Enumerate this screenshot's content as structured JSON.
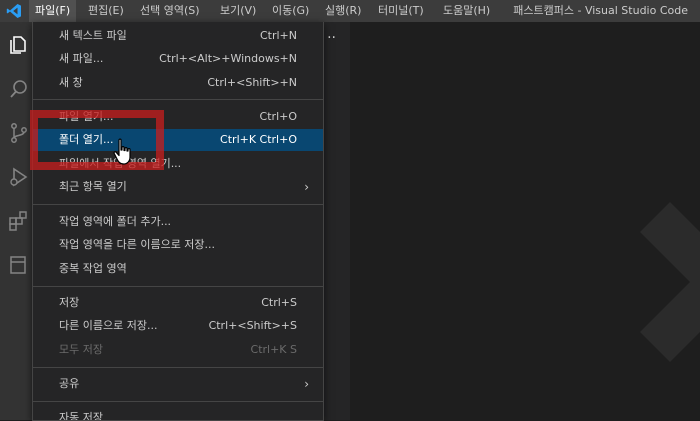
{
  "menubar": {
    "items": [
      {
        "label": "파일(F)",
        "active": true
      },
      {
        "label": "편집(E)"
      },
      {
        "label": "선택 영역(S)"
      },
      {
        "label": "보기(V)"
      },
      {
        "label": "이동(G)"
      },
      {
        "label": "실행(R)"
      },
      {
        "label": "터미널(T)"
      },
      {
        "label": "도움말(H)"
      }
    ],
    "window_title": "패스트캠퍼스 - Visual Studio Code"
  },
  "sidebar": {
    "more": "··"
  },
  "file_menu": {
    "items": [
      {
        "label": "새 텍스트 파일",
        "shortcut": "Ctrl+N"
      },
      {
        "label": "새 파일...",
        "shortcut": "Ctrl+<Alt>+Windows+N"
      },
      {
        "label": "새 창",
        "shortcut": "Ctrl+<Shift>+N"
      },
      {
        "label": "파일 열기...",
        "shortcut": "Ctrl+O"
      },
      {
        "label": "폴더 열기...",
        "shortcut": "Ctrl+K Ctrl+O",
        "selected": true
      },
      {
        "label": "파일에서 작업 영역 열기..."
      },
      {
        "label": "최근 항목 열기",
        "arrow": "›"
      },
      {
        "label": "작업 영역에 폴더 추가..."
      },
      {
        "label": "작업 영역을 다른 이름으로 저장..."
      },
      {
        "label": "중복 작업 영역"
      },
      {
        "label": "저장",
        "shortcut": "Ctrl+S"
      },
      {
        "label": "다른 이름으로 저장...",
        "shortcut": "Ctrl+<Shift>+S"
      },
      {
        "label": "모두 저장",
        "shortcut": "Ctrl+K S",
        "disabled": true
      },
      {
        "label": "공유",
        "arrow": "›"
      },
      {
        "label": "자동 저장"
      }
    ]
  },
  "colors": {
    "selection": "#094771",
    "highlight": "#c81e1e",
    "menubar": "#3c3c3c",
    "activitybar": "#333333"
  }
}
